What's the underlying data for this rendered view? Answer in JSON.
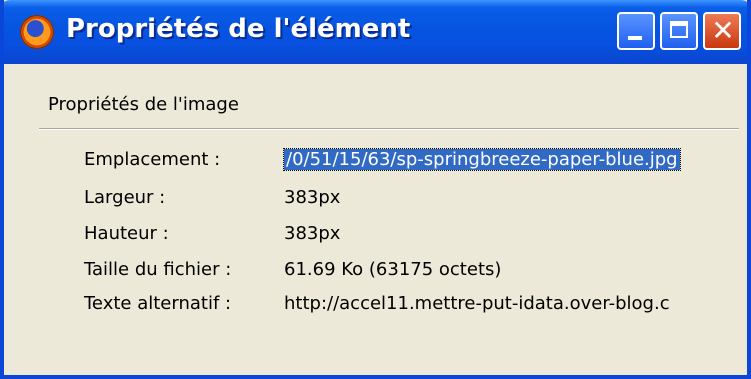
{
  "window": {
    "title": "Propriétés de l'élément",
    "icon": "firefox-icon",
    "controls": {
      "minimize": "minimize-icon",
      "maximize": "maximize-icon",
      "close": "close-icon"
    }
  },
  "section": {
    "title": "Propriétés de l'image"
  },
  "properties": [
    {
      "label": "Emplacement :",
      "value": "/0/51/15/63/sp-springbreeze-paper-blue.jpg",
      "selected": true
    },
    {
      "label": "Largeur :",
      "value": "383px"
    },
    {
      "label": "Hauteur :",
      "value": "383px"
    },
    {
      "label": "Taille du fichier :",
      "value": "61.69 Ko (63175 octets)"
    },
    {
      "label": "Texte alternatif :",
      "value": "http://accel11.mettre-put-idata.over-blog.c"
    }
  ],
  "colors": {
    "titlebar": "#0654df",
    "selection": "#316ac5",
    "close_button": "#c9380f",
    "dialog_background": "#ece9d8"
  }
}
